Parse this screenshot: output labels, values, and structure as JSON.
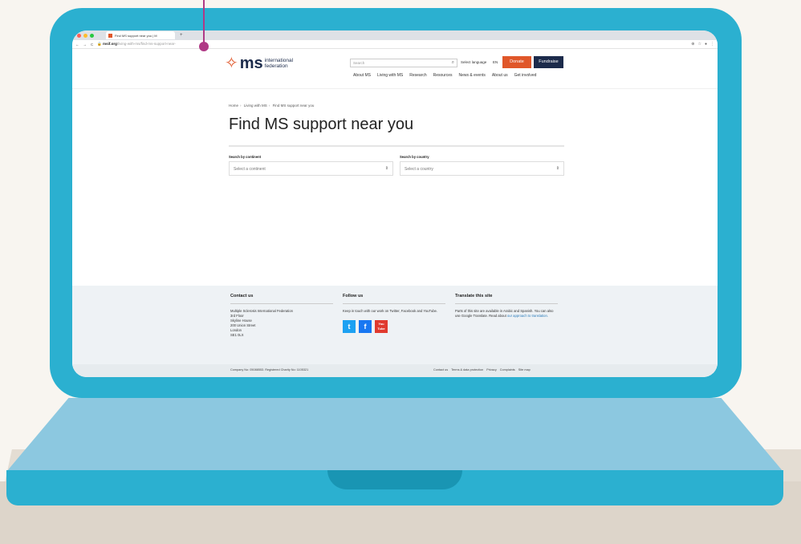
{
  "browser": {
    "tab_title": "Find MS support near you | M",
    "new_tab": "+",
    "url_domain": "msif.org",
    "url_path": "/living-with-ms/find-ms-support-near-",
    "nav_controls": [
      "←",
      "→",
      "C",
      "🔒"
    ],
    "extension_icons": [
      "⊕",
      "☆",
      "●",
      "⋮"
    ]
  },
  "header": {
    "logo_mark": "✧",
    "logo_ms": "ms",
    "logo_line1": "international",
    "logo_line2": "federation",
    "search_placeholder": "Search",
    "search_icon": "⌕",
    "select_language": "Select language",
    "lang_code": "EN",
    "donate_label": "Donate",
    "fundraise_label": "Fundraise",
    "nav": [
      "About MS",
      "Living with MS",
      "Research",
      "Resources",
      "News & events",
      "About us",
      "Get involved"
    ]
  },
  "breadcrumb": [
    "Home",
    "Living with MS",
    "Find MS support near you"
  ],
  "page_title": "Find MS support near you",
  "filters": {
    "continent_label": "Search by continent",
    "continent_value": "Select a continent",
    "country_label": "Search by country",
    "country_value": "Select a country",
    "arrow": "⇕"
  },
  "footer": {
    "contact_title": "Contact us",
    "contact_lines": [
      "Multiple Sclerosis International Federation",
      "3rd Floor",
      "Skyline House",
      "200 Union Street",
      "London",
      "SE1 0LX"
    ],
    "follow_title": "Follow us",
    "follow_text": "Keep in touch with our work on Twitter, Facebook and YouTube.",
    "social": [
      "t",
      "f",
      "You Tube"
    ],
    "translate_title": "Translate this site",
    "translate_text": "Parts of this site are available in Arabic and Spanish. You can also use Google Translate. Read about",
    "translate_link": "our approach to translation.",
    "company": "Company No: 05088553. Registered Charity No: 1105321",
    "links": [
      "Contact us",
      "Terms & data protection",
      "Privacy",
      "Complaints",
      "Site map"
    ]
  },
  "colors": {
    "laptop": "#2bb0d0",
    "laptop_base": "#8cc8e0",
    "donate": "#e0572a",
    "navy": "#1c2b4b",
    "pointer": "#b03a86"
  }
}
